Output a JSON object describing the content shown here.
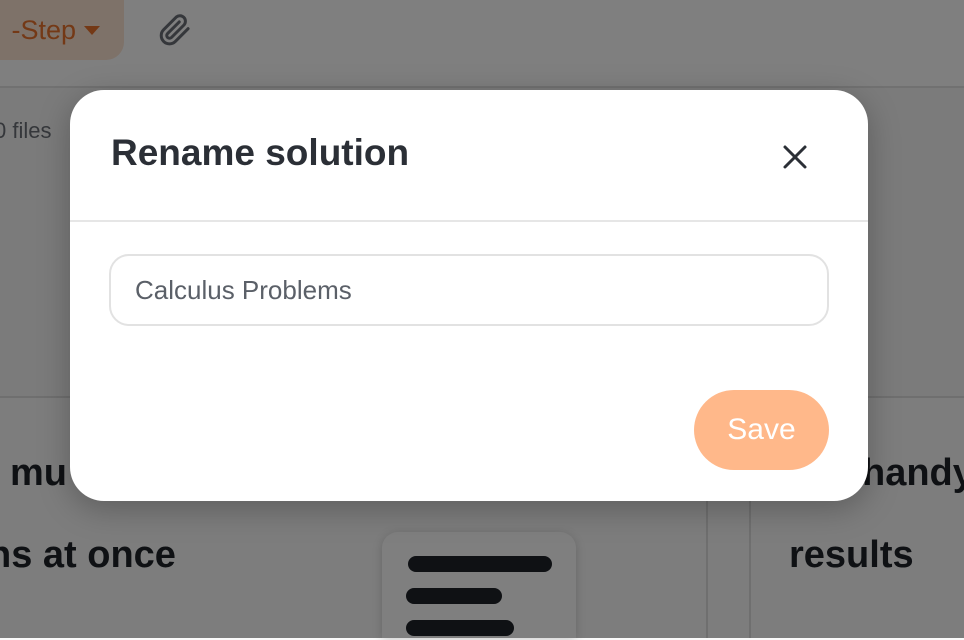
{
  "background": {
    "step_selector_label": "-Step",
    "attach_icon": "paperclip-icon",
    "files_text": "0 files",
    "cards": [
      {
        "line1": "mu",
        "line2": "ns at once"
      },
      {
        "line1": "handy",
        "line2": "results"
      }
    ]
  },
  "modal": {
    "title": "Rename solution",
    "close_icon": "close-icon",
    "input_value": "Calculus Problems",
    "save_label": "Save"
  },
  "colors": {
    "accent": "#e8722c",
    "accent_light": "#fde4d2",
    "save_button": "#ffb88a",
    "overlay": "rgba(0,0,0,0.5)"
  }
}
